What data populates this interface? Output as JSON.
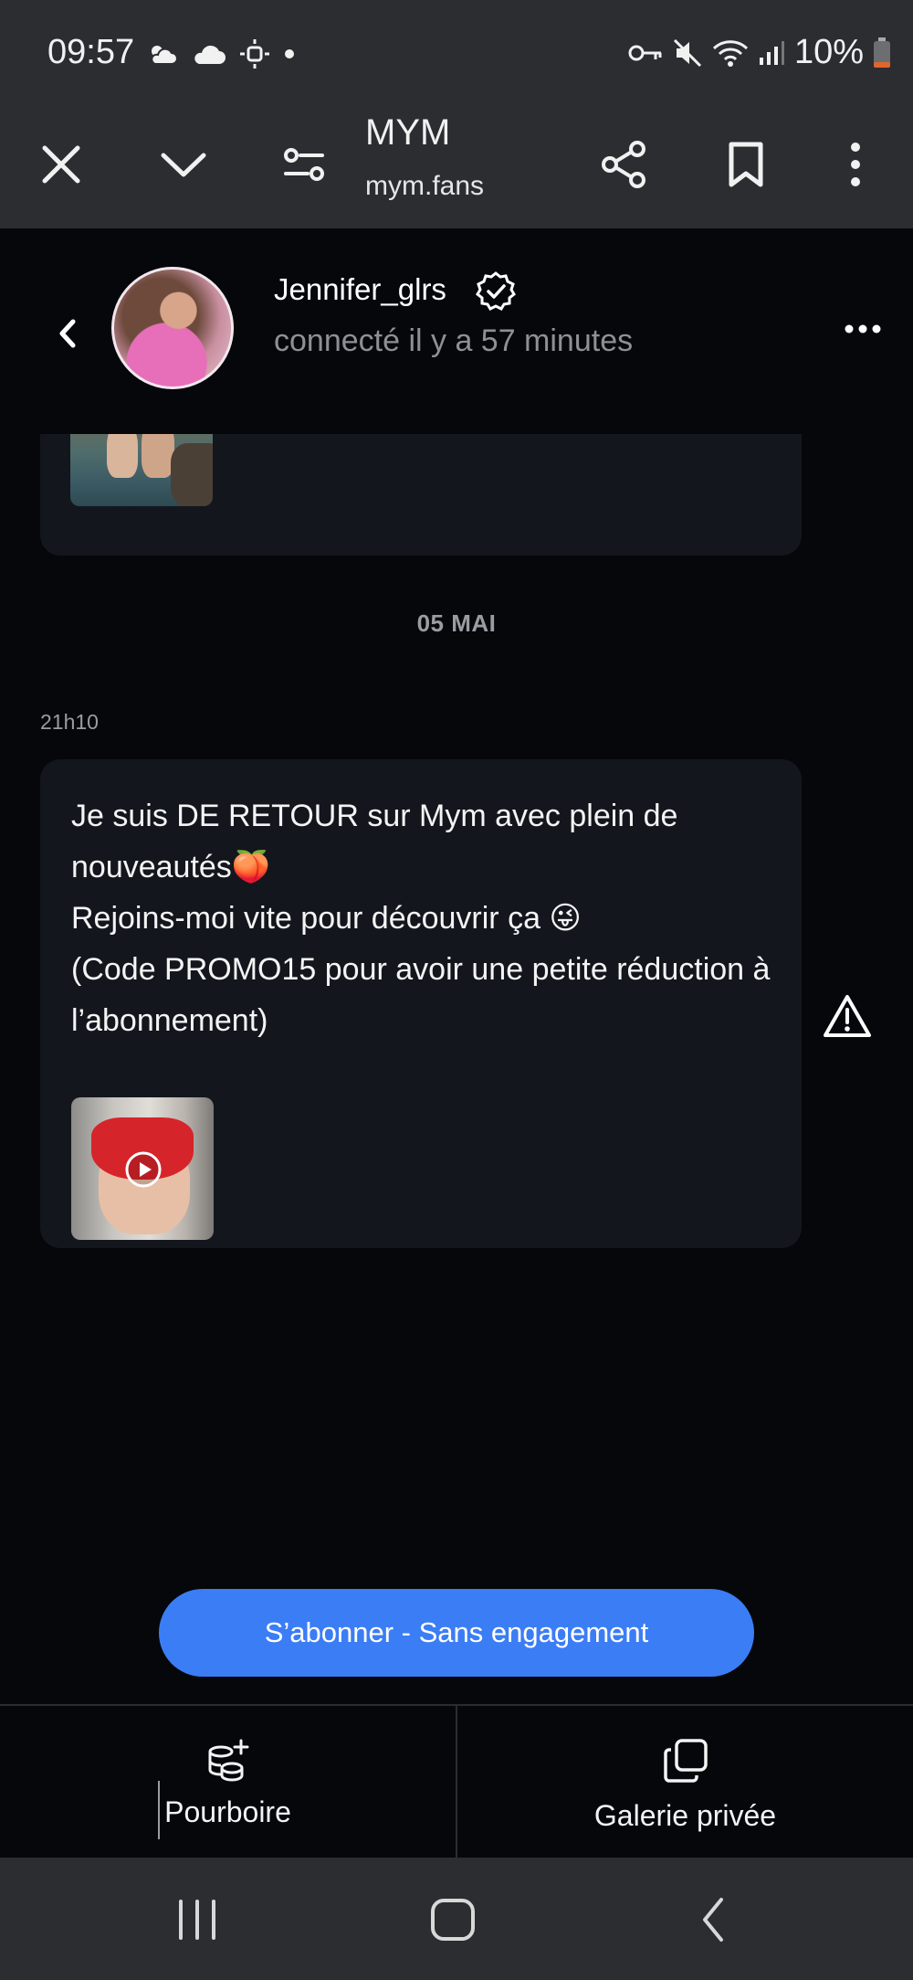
{
  "status_bar": {
    "time": "09:57",
    "battery": "10%",
    "left_icons": [
      "partly-cloudy-icon",
      "cloud-icon",
      "brightness-icon",
      "dot-icon"
    ],
    "right_icons": [
      "key-icon",
      "mute-icon",
      "wifi-icon",
      "signal-icon",
      "battery-icon"
    ]
  },
  "browser": {
    "title": "MYM",
    "url": "mym.fans"
  },
  "chat_header": {
    "username": "Jennifer_glrs",
    "last_seen": "connecté il y a 57 minutes"
  },
  "chat": {
    "date_separator": "05 MAI",
    "message_time": "21h10",
    "message_text": "Je suis DE RETOUR sur Mym avec plein de nouveautés🍑\nRejoins-moi vite pour découvrir ça 😜\n(Code PROMO15 pour avoir une petite réduction à l’abonnement)"
  },
  "subscribe_button": "S’abonner - Sans engagement",
  "actions": {
    "tip_label": "Pourboire",
    "gallery_label": "Galerie privée"
  },
  "colors": {
    "accent": "#3b7df5",
    "bubble": "#13161d",
    "background": "#05070b",
    "chrome": "#2c2d31"
  }
}
